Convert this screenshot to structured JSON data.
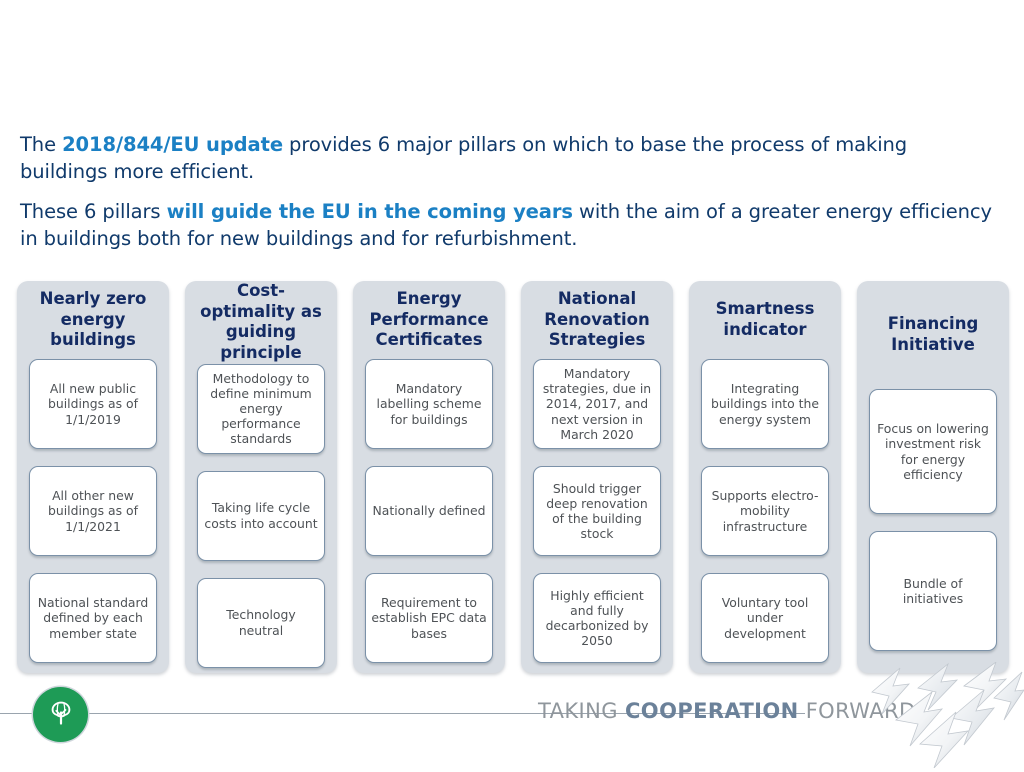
{
  "intro": {
    "paragraph1": {
      "pre": "The ",
      "highlight": "2018/844/EU update",
      "post": " provides 6 major pillars on which to base the process of making buildings more efficient."
    },
    "paragraph2": {
      "pre": "These 6 pillars ",
      "highlight": "will guide the EU in the coming years",
      "post": " with the aim of a greater energy efficiency in buildings both for new buildings and for refurbishment."
    }
  },
  "colors": {
    "body_text": "#103a6b",
    "highlight_text": "#1b80c4",
    "pillar_header_text": "#142b63",
    "pillar_background": "#d8dde3",
    "card_background": "#ffffff",
    "card_border": "#7b91a8",
    "card_text": "#4e5256",
    "logo_green": "#1e9b56",
    "tagline_gray": "#8f969c",
    "tagline_blue": "#6b8199"
  },
  "pillars": [
    {
      "title": "Nearly zero energy buildings",
      "cards": [
        "All new public buildings as of 1/1/2019",
        "All other new buildings as of 1/1/2021",
        "National standard defined by each member state"
      ]
    },
    {
      "title": "Cost-optimality as guiding principle",
      "cards": [
        "Methodology to define minimum energy performance standards",
        "Taking life cycle costs into account",
        "Technology neutral"
      ]
    },
    {
      "title": "Energy Performance Certificates",
      "cards": [
        "Mandatory labelling scheme for buildings",
        "Nationally defined",
        "Requirement to establish EPC data bases"
      ]
    },
    {
      "title": "National Renovation Strategies",
      "cards": [
        "Mandatory strategies, due in 2014, 2017, and next version in March 2020",
        "Should trigger deep renovation of the building stock",
        "Highly efficient and fully decarbonized by 2050"
      ]
    },
    {
      "title": "Smartness indicator",
      "cards": [
        "Integrating buildings into the energy system",
        "Supports electro-mobility infrastructure",
        "Voluntary tool under development"
      ]
    },
    {
      "title": "Financing Initiative",
      "cards": [
        "Focus on lowering investment risk for energy efficiency",
        "Bundle of initiatives"
      ]
    }
  ],
  "footer": {
    "tagline_part1": "TAKING ",
    "tagline_part2": "COOPERATION",
    "tagline_part3": " FORWARD",
    "logo_icon": "tree-icon"
  }
}
